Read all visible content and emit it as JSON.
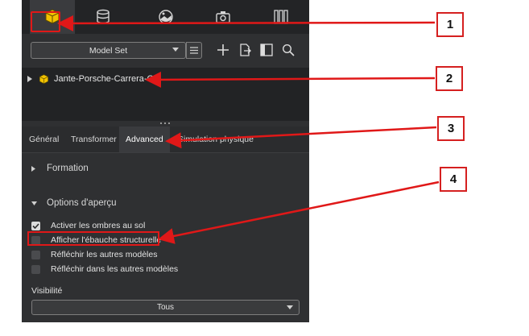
{
  "icon_tabs": [
    {
      "icon": "model-cube-icon",
      "active": true
    },
    {
      "icon": "database-icon",
      "active": false
    },
    {
      "icon": "environment-icon",
      "active": false
    },
    {
      "icon": "camera-icon",
      "active": false
    },
    {
      "icon": "columns-icon",
      "active": false
    }
  ],
  "toolbar": {
    "model_set": "Model Set"
  },
  "tree": {
    "item_label": "Jante-Porsche-Carrera-GT"
  },
  "tabs": [
    "Général",
    "Transformer",
    "Advanced",
    "Simulation physique"
  ],
  "sections": {
    "formation": "Formation",
    "preview": "Options d'aperçu"
  },
  "options": [
    {
      "label": "Activer les ombres au sol",
      "checked": true
    },
    {
      "label": "Afficher l'ébauche structurelle",
      "checked": false
    },
    {
      "label": "Réfléchir les autres modèles",
      "checked": false
    },
    {
      "label": "Réfléchir dans les autres modèles",
      "checked": false
    }
  ],
  "visibility": {
    "label": "Visibilité",
    "value": "Tous"
  },
  "callouts": [
    "1",
    "2",
    "3",
    "4"
  ],
  "colors": {
    "accent": "#f2c200",
    "callout_red": "#e01818",
    "panel_bg": "#2f3032"
  }
}
